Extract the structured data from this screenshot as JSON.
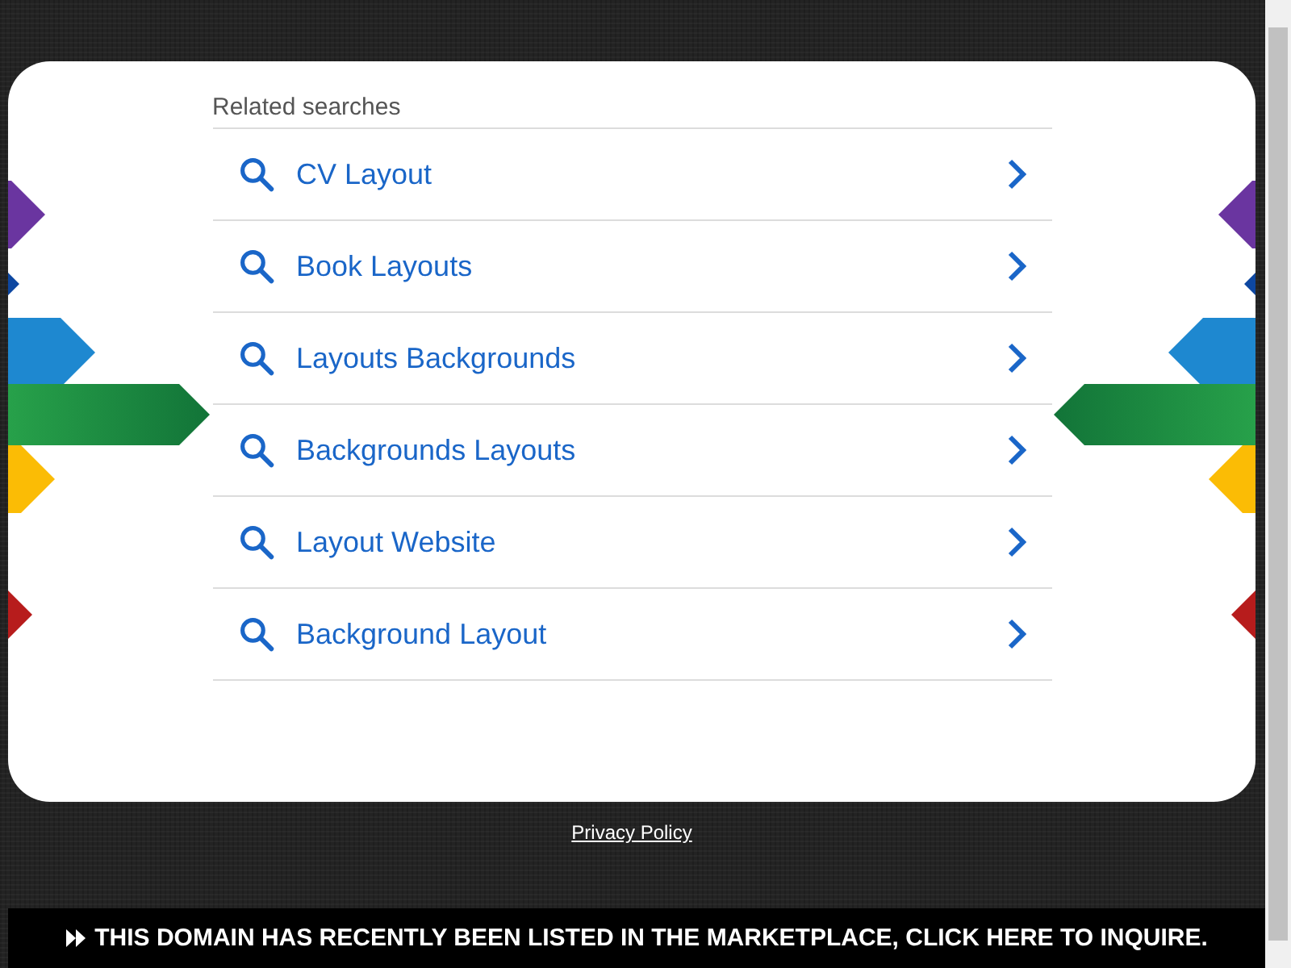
{
  "related_searches": {
    "title": "Related searches",
    "items": [
      {
        "label": "CV Layout"
      },
      {
        "label": "Book Layouts"
      },
      {
        "label": "Layouts Backgrounds"
      },
      {
        "label": "Backgrounds Layouts"
      },
      {
        "label": "Layout Website"
      },
      {
        "label": "Background Layout"
      }
    ]
  },
  "privacy_link": "Privacy Policy",
  "banner": "THIS DOMAIN HAS RECENTLY BEEN LISTED IN THE MARKETPLACE, CLICK HERE TO INQUIRE."
}
